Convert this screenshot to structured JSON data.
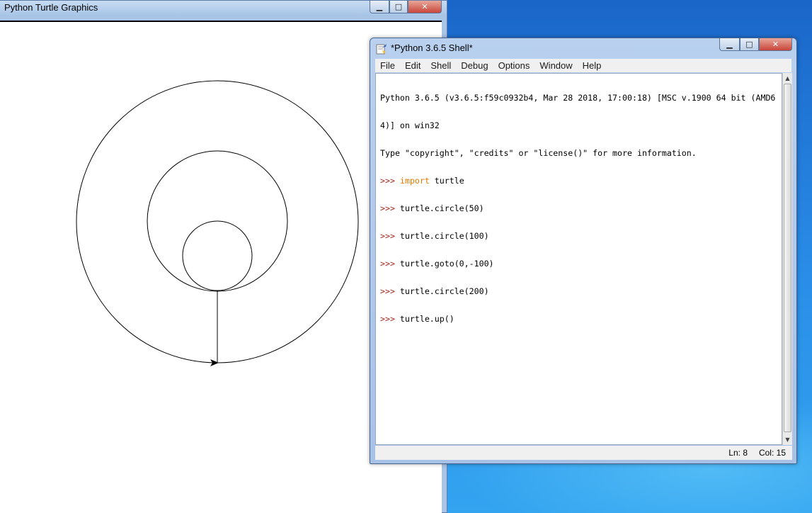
{
  "turtle_window": {
    "title": "Python Turtle Graphics",
    "icons": {
      "minimize": "minimize-icon",
      "maximize": "maximize-icon",
      "close": "close-icon"
    },
    "glyphs": {
      "minimize": "▁",
      "maximize": "□",
      "close": "✕"
    },
    "drawing": {
      "stroke": "#000000",
      "background": "#ffffff"
    }
  },
  "shell_window": {
    "title": "*Python 3.6.5 Shell*",
    "icons": {
      "app": "python-idle-icon",
      "minimize": "minimize-icon",
      "maximize": "maximize-icon",
      "close": "close-icon"
    },
    "glyphs": {
      "minimize": "▁",
      "maximize": "□",
      "close": "✕"
    },
    "menu": [
      "File",
      "Edit",
      "Shell",
      "Debug",
      "Options",
      "Window",
      "Help"
    ],
    "lines": [
      {
        "prompt": "",
        "keyword": "",
        "text": "Python 3.6.5 (v3.6.5:f59c0932b4, Mar 28 2018, 17:00:18) [MSC v.1900 64 bit (AMD6"
      },
      {
        "prompt": "",
        "keyword": "",
        "text": "4)] on win32"
      },
      {
        "prompt": "",
        "keyword": "",
        "text": "Type \"copyright\", \"credits\" or \"license()\" for more information."
      },
      {
        "prompt": ">>> ",
        "keyword": "import",
        "text": " turtle"
      },
      {
        "prompt": ">>> ",
        "keyword": "",
        "text": "turtle.circle(50)"
      },
      {
        "prompt": ">>> ",
        "keyword": "",
        "text": "turtle.circle(100)"
      },
      {
        "prompt": ">>> ",
        "keyword": "",
        "text": "turtle.goto(0,-100)"
      },
      {
        "prompt": ">>> ",
        "keyword": "",
        "text": "turtle.circle(200)"
      },
      {
        "prompt": ">>> ",
        "keyword": "",
        "text": "turtle.up()"
      }
    ],
    "scroll": {
      "up_glyph": "▲",
      "down_glyph": "▼"
    },
    "status": {
      "ln": "Ln: 8",
      "col": "Col: 15"
    },
    "colors": {
      "prompt": "#a0281a",
      "keyword": "#e07b00",
      "text": "#000000"
    }
  }
}
